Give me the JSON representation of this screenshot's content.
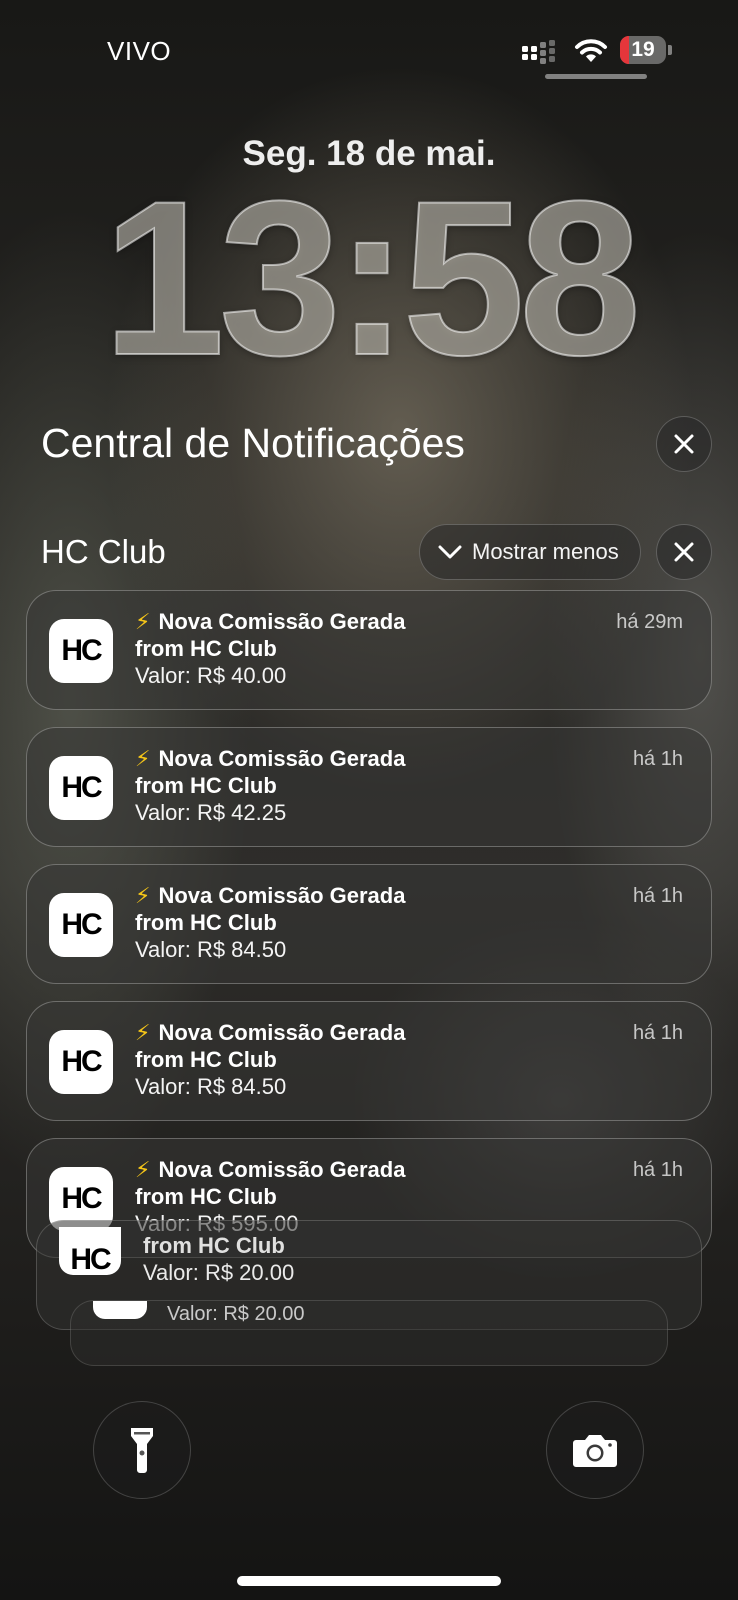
{
  "status_bar": {
    "carrier": "VIVO",
    "signal_icon": "cellular-signal-icon",
    "wifi_icon": "wifi-icon",
    "battery_level": "19",
    "battery_fill_percent": 19,
    "battery_color": "#e5363b"
  },
  "lockscreen": {
    "date": "Seg. 18 de mai.",
    "time": "13:58"
  },
  "notification_center": {
    "title": "Central de Notificações",
    "close_icon": "close-icon"
  },
  "group": {
    "app_name": "HC Club",
    "show_less_label": "Mostrar menos",
    "show_less_icon": "chevron-down-icon",
    "close_icon": "close-icon"
  },
  "notifications": [
    {
      "title": "Nova Comissão Gerada",
      "subtitle": "from HC Club",
      "body": "Valor: R$ 40.00",
      "time": "há 29m"
    },
    {
      "title": "Nova Comissão Gerada",
      "subtitle": "from HC Club",
      "body": "Valor: R$ 42.25",
      "time": "há 1h"
    },
    {
      "title": "Nova Comissão Gerada",
      "subtitle": "from HC Club",
      "body": "Valor: R$ 84.50",
      "time": "há 1h"
    },
    {
      "title": "Nova Comissão Gerada",
      "subtitle": "from HC Club",
      "body": "Valor: R$ 84.50",
      "time": "há 1h"
    },
    {
      "title": "Nova Comissão Gerada",
      "subtitle": "from HC Club",
      "body": "Valor: R$ 595.00",
      "time": "há 1h"
    }
  ],
  "stacked_notifications": [
    {
      "subtitle": "from HC Club",
      "body": "Valor: R$ 20.00"
    },
    {
      "body": "Valor: R$ 20.00"
    }
  ],
  "notification_emoji": "⚡",
  "app_icon_text": "HC",
  "quick_actions": {
    "flashlight_icon": "flashlight-icon",
    "camera_icon": "camera-icon"
  }
}
